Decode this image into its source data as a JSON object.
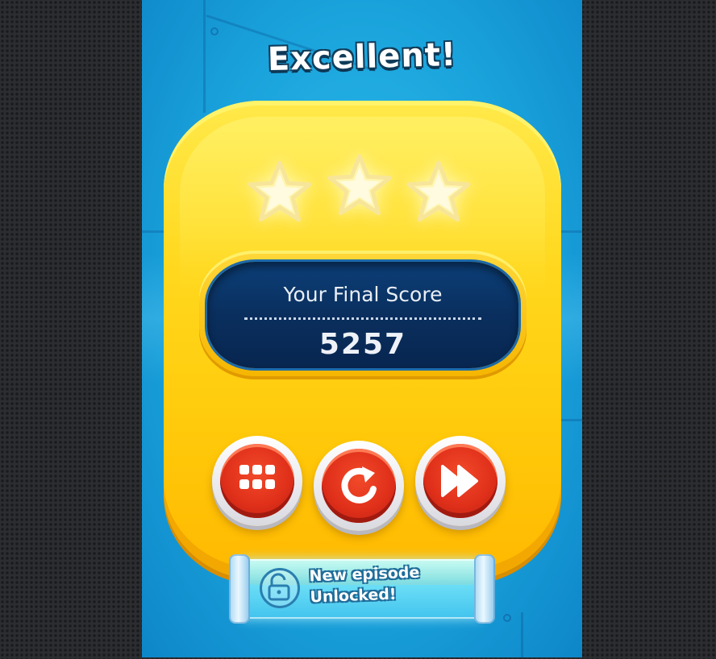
{
  "result": {
    "title": "Excellent!",
    "stars_earned": 3,
    "stars_total": 3
  },
  "score": {
    "label": "Your Final Score",
    "value": "5257"
  },
  "actions": [
    {
      "id": "level-menu",
      "icon": "grid-icon"
    },
    {
      "id": "replay",
      "icon": "replay-icon"
    },
    {
      "id": "next",
      "icon": "fast-forward-icon"
    }
  ],
  "banner": {
    "icon": "unlocked-padlock-icon",
    "line1": "New episode",
    "line2": "Unlocked!"
  },
  "colors": {
    "background": "#1aa3dc",
    "panel": "#ffd81e",
    "score_box": "#0a2f5e",
    "button": "#e0301a"
  }
}
